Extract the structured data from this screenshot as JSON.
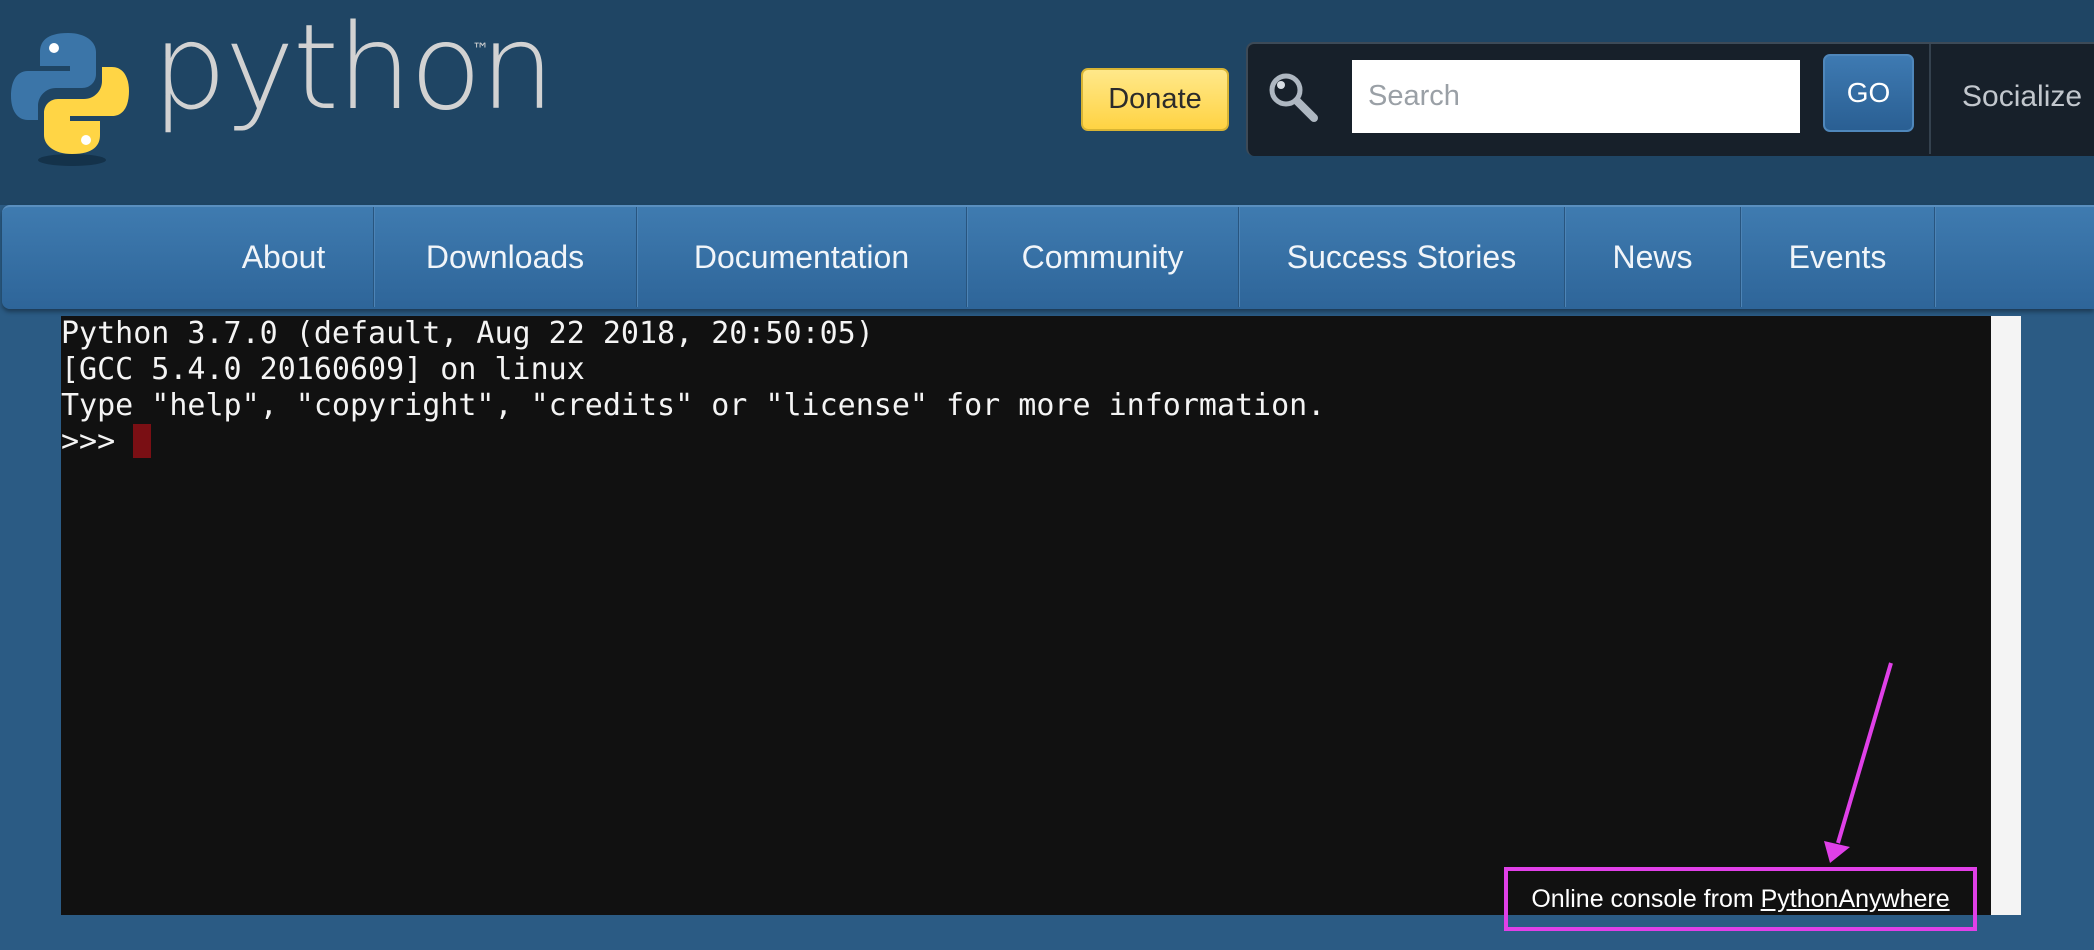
{
  "header": {
    "logo_text": "python",
    "trademark": "™",
    "donate_label": "Donate",
    "search_placeholder": "Search",
    "go_label": "GO",
    "socialize_label": "Socialize"
  },
  "nav": {
    "items": [
      {
        "label": "About"
      },
      {
        "label": "Downloads"
      },
      {
        "label": "Documentation"
      },
      {
        "label": "Community"
      },
      {
        "label": "Success Stories"
      },
      {
        "label": "News"
      },
      {
        "label": "Events"
      }
    ]
  },
  "console": {
    "lines": [
      "Python 3.7.0 (default, Aug 22 2018, 20:50:05)",
      "[GCC 5.4.0 20160609] on linux",
      "Type \"help\", \"copyright\", \"credits\" or \"license\" for more information.",
      ">>> "
    ],
    "credit_prefix": "Online console from ",
    "credit_link": "PythonAnywhere"
  },
  "colors": {
    "header_bg": "#1f4564",
    "nav_bg": "#3f7bb0",
    "donate_yellow": "#ffd343",
    "console_bg": "#111111",
    "annotation_magenta": "#e040e8"
  },
  "icons": {
    "logo": "python-logo-icon",
    "search": "magnifier-icon"
  }
}
